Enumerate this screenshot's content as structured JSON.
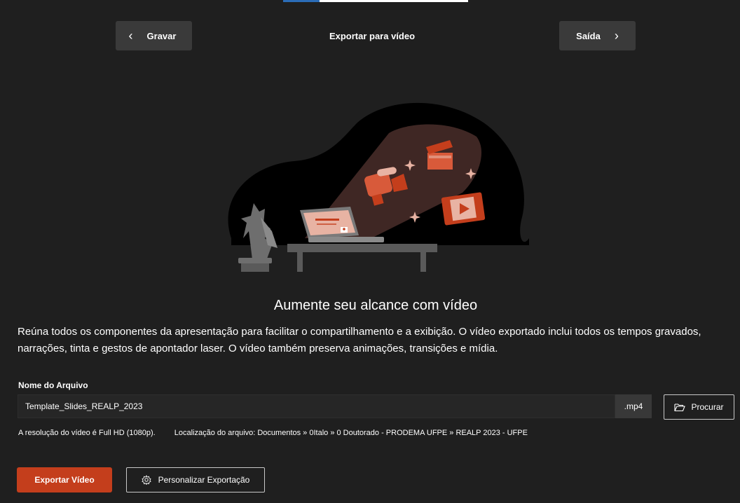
{
  "header": {
    "back_label": "Gravar",
    "back_icon": "chevron-left-icon",
    "title": "Exportar para vídeo",
    "exit_label": "Saída",
    "exit_icon": "chevron-right-icon"
  },
  "hero": {
    "headline": "Aumente seu alcance com vídeo",
    "description": "Reúna todos os componentes da apresentação para facilitar o compartilhamento e a exibição. O vídeo exportado inclui todos os tempos gravados, narrações, tinta e gestos de apontador laser. O vídeo também preserva animações, transições e mídia."
  },
  "file": {
    "label": "Nome do Arquivo",
    "value": "Template_Slides_REALP_2023",
    "extension": ".mp4",
    "browse_label": "Procurar",
    "browse_icon": "folder-open-icon"
  },
  "info": {
    "resolution": "A resolução do vídeo é Full HD (1080p).",
    "location": "Localização do arquivo: Documentos » 0Italo » 0 Doutorado - PRODEMA UFPE » REALP 2023 - UFPE"
  },
  "actions": {
    "export_label": "Exportar Vídeo",
    "customize_label": "Personalizar Exportação",
    "customize_icon": "settings-gear-icon"
  },
  "colors": {
    "background": "#1f1f1f",
    "accent": "#c43e1c",
    "button_dark": "#3a3a3a"
  }
}
